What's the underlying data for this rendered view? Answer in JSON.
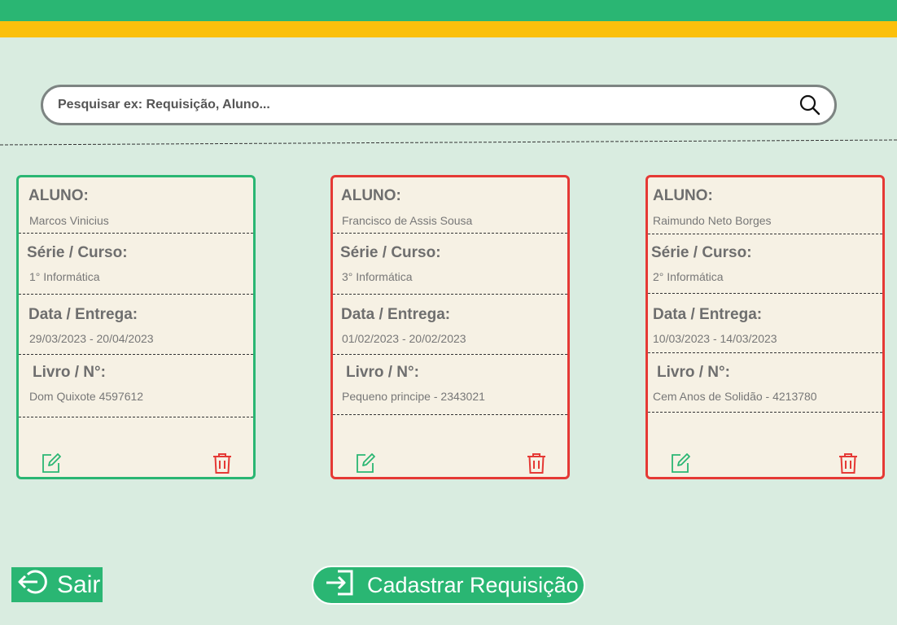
{
  "search": {
    "placeholder": "Pesquisar ex: Requisição, Aluno..."
  },
  "labels": {
    "aluno": "ALUNO:",
    "serie": "Série / Curso:",
    "data": "Data / Entrega:",
    "livro": "Livro / N°:"
  },
  "cards": [
    {
      "status": "green",
      "aluno": "Marcos Vinicius",
      "serie": "1° Informática",
      "data": "29/03/2023 - 20/04/2023",
      "livro": "Dom Quixote 4597612"
    },
    {
      "status": "red",
      "aluno": "Francisco de Assis Sousa",
      "serie": "3° Informática",
      "data": "01/02/2023 - 20/02/2023",
      "livro": "Pequeno principe - 2343021"
    },
    {
      "status": "red",
      "aluno": "Raimundo Neto Borges",
      "serie": "2° Informática",
      "data": "10/03/2023 - 14/03/2023",
      "livro": "Cem Anos de Solidão - 4213780"
    }
  ],
  "buttons": {
    "sair": "Sair",
    "cadastrar": "Cadastrar Requisição"
  },
  "icons": {
    "search": "search-icon",
    "edit": "edit-icon",
    "delete": "trash-icon",
    "logout": "logout-icon",
    "login": "enter-icon"
  },
  "colors": {
    "green": "#2ab673",
    "yellow": "#fbc00c",
    "red": "#e53935",
    "background": "#d9ece0",
    "card": "#f6f1e4"
  }
}
